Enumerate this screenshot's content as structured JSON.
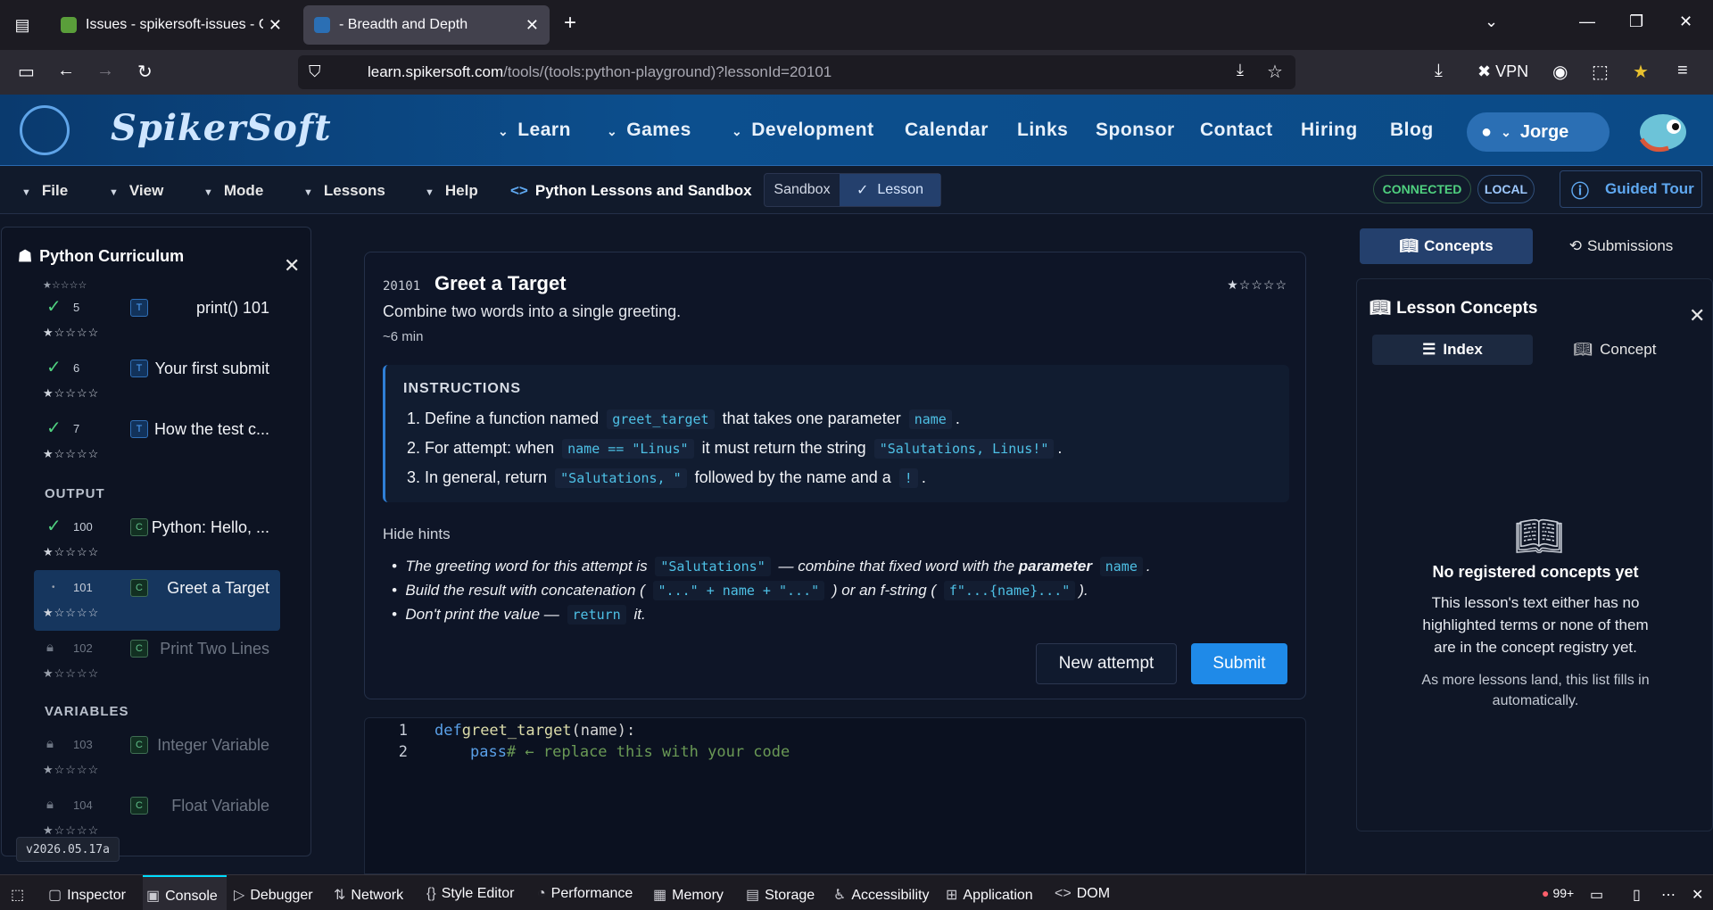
{
  "browser": {
    "tabs": [
      {
        "title": "Issues - spikersoft-issues - Gitea",
        "active": false
      },
      {
        "title": "- Breadth and Depth",
        "active": true
      }
    ],
    "url": {
      "host": "learn.spikersoft.com",
      "path": "/tools/(tools:python-playground)?lessonId=20101"
    },
    "vpn_label": "VPN"
  },
  "site": {
    "logo": "SpikerSoft",
    "nav": [
      {
        "label": "Learn",
        "dropdown": true
      },
      {
        "label": "Games",
        "dropdown": true
      },
      {
        "label": "Development",
        "dropdown": true
      },
      {
        "label": "Calendar",
        "dropdown": false
      },
      {
        "label": "Links",
        "dropdown": false
      },
      {
        "label": "Sponsor",
        "dropdown": false
      },
      {
        "label": "Contact",
        "dropdown": false
      },
      {
        "label": "Hiring",
        "dropdown": false
      },
      {
        "label": "Blog",
        "dropdown": false
      }
    ],
    "user": "Jorge"
  },
  "toolbar": {
    "menus": [
      "File",
      "View",
      "Mode",
      "Lessons",
      "Help"
    ],
    "app_title": "Python Lessons and Sandbox",
    "modes": [
      "Sandbox",
      "Lesson"
    ],
    "active_mode": "Lesson",
    "status_connected": "CONNECTED",
    "status_local": "LOCAL",
    "guided_tour": "Guided Tour"
  },
  "curriculum": {
    "title": "Python Curriculum",
    "sections": [
      {
        "label": "OUTPUT"
      },
      {
        "label": "VARIABLES"
      }
    ],
    "items": [
      {
        "num": "5",
        "type": "T",
        "name": "print() 101",
        "done": true,
        "stars": "★☆☆☆☆"
      },
      {
        "num": "6",
        "type": "T",
        "name": "Your first submit",
        "done": true,
        "stars": "★☆☆☆☆"
      },
      {
        "num": "7",
        "type": "T",
        "name": "How the test c...",
        "done": true,
        "stars": "★☆☆☆☆"
      },
      {
        "num": "100",
        "type": "C",
        "name": "Python: Hello, ...",
        "done": true,
        "stars": "★☆☆☆☆"
      },
      {
        "num": "101",
        "type": "C",
        "name": "Greet a Target",
        "done": false,
        "selected": true,
        "stars": "★☆☆☆☆"
      },
      {
        "num": "102",
        "type": "C",
        "name": "Print Two Lines",
        "locked": true,
        "stars": "★☆☆☆☆"
      },
      {
        "num": "103",
        "type": "C",
        "name": "Integer Variable",
        "locked": true,
        "stars": "★☆☆☆☆"
      },
      {
        "num": "104",
        "type": "C",
        "name": "Float Variable",
        "locked": true,
        "stars": "★☆☆☆☆"
      }
    ],
    "version": "v2026.05.17a"
  },
  "lesson": {
    "id": "20101",
    "title": "Greet a Target",
    "subtitle": "Combine two words into a single greeting.",
    "duration": "~6 min",
    "stars": "★☆☆☆☆",
    "instructions_heading": "INSTRUCTIONS",
    "instructions": [
      {
        "n": "1.",
        "a": "Define a function named",
        "c1": "greet_target",
        "b": "that takes one parameter",
        "c2": "name",
        "d": "."
      },
      {
        "n": "2.",
        "a": "For attempt: when",
        "c1": "name == \"Linus\"",
        "b": "it must return the string",
        "c2": "\"Salutations, Linus!\"",
        "d": "."
      },
      {
        "n": "3.",
        "a": "In general, return",
        "c1": "\"Salutations, \"",
        "b": "followed by the name and a",
        "c2": "!",
        "d": "."
      }
    ],
    "hide_hints": "Hide hints",
    "hints": [
      {
        "a": "The greeting word for this attempt is",
        "c1": "\"Salutations\"",
        "b": "— combine that fixed word with the",
        "bold": "parameter",
        "c2": "name",
        "d": "."
      },
      {
        "a": "Build the result with concatenation (",
        "c1": "\"...\" + name + \"...\"",
        "b": ") or an f-string (",
        "bold": "",
        "c2": "f\"...{name}...\"",
        "d": ")."
      },
      {
        "a": "Don't print the value —",
        "c1": "return",
        "b": "it.",
        "bold": "",
        "c2": "",
        "d": ""
      }
    ],
    "new_attempt": "New attempt",
    "submit": "Submit"
  },
  "editor": {
    "lines": [
      {
        "n": "1",
        "kw": "def",
        "fn": "greet_target",
        "rest": "(name):"
      },
      {
        "n": "2",
        "kw": "pass",
        "comment": "# ← replace this with your code"
      }
    ]
  },
  "concepts": {
    "tabs": [
      "Concepts",
      "Submissions"
    ],
    "panel_title": "Lesson Concepts",
    "subtabs": [
      "Index",
      "Concept"
    ],
    "empty_title": "No registered concepts yet",
    "empty_body": "This lesson's text either has no highlighted terms or none of them are in the concept registry yet.",
    "empty_note": "As more lessons land, this list fills in automatically."
  },
  "devtools": {
    "tabs": [
      "Inspector",
      "Console",
      "Debugger",
      "Network",
      "Style Editor",
      "Performance",
      "Memory",
      "Storage",
      "Accessibility",
      "Application",
      "DOM"
    ],
    "active": "Console",
    "errors": "99+"
  },
  "colors": {
    "accent": "#1f8ae8",
    "header": "#0c4f8e",
    "success": "#4fd07f"
  }
}
